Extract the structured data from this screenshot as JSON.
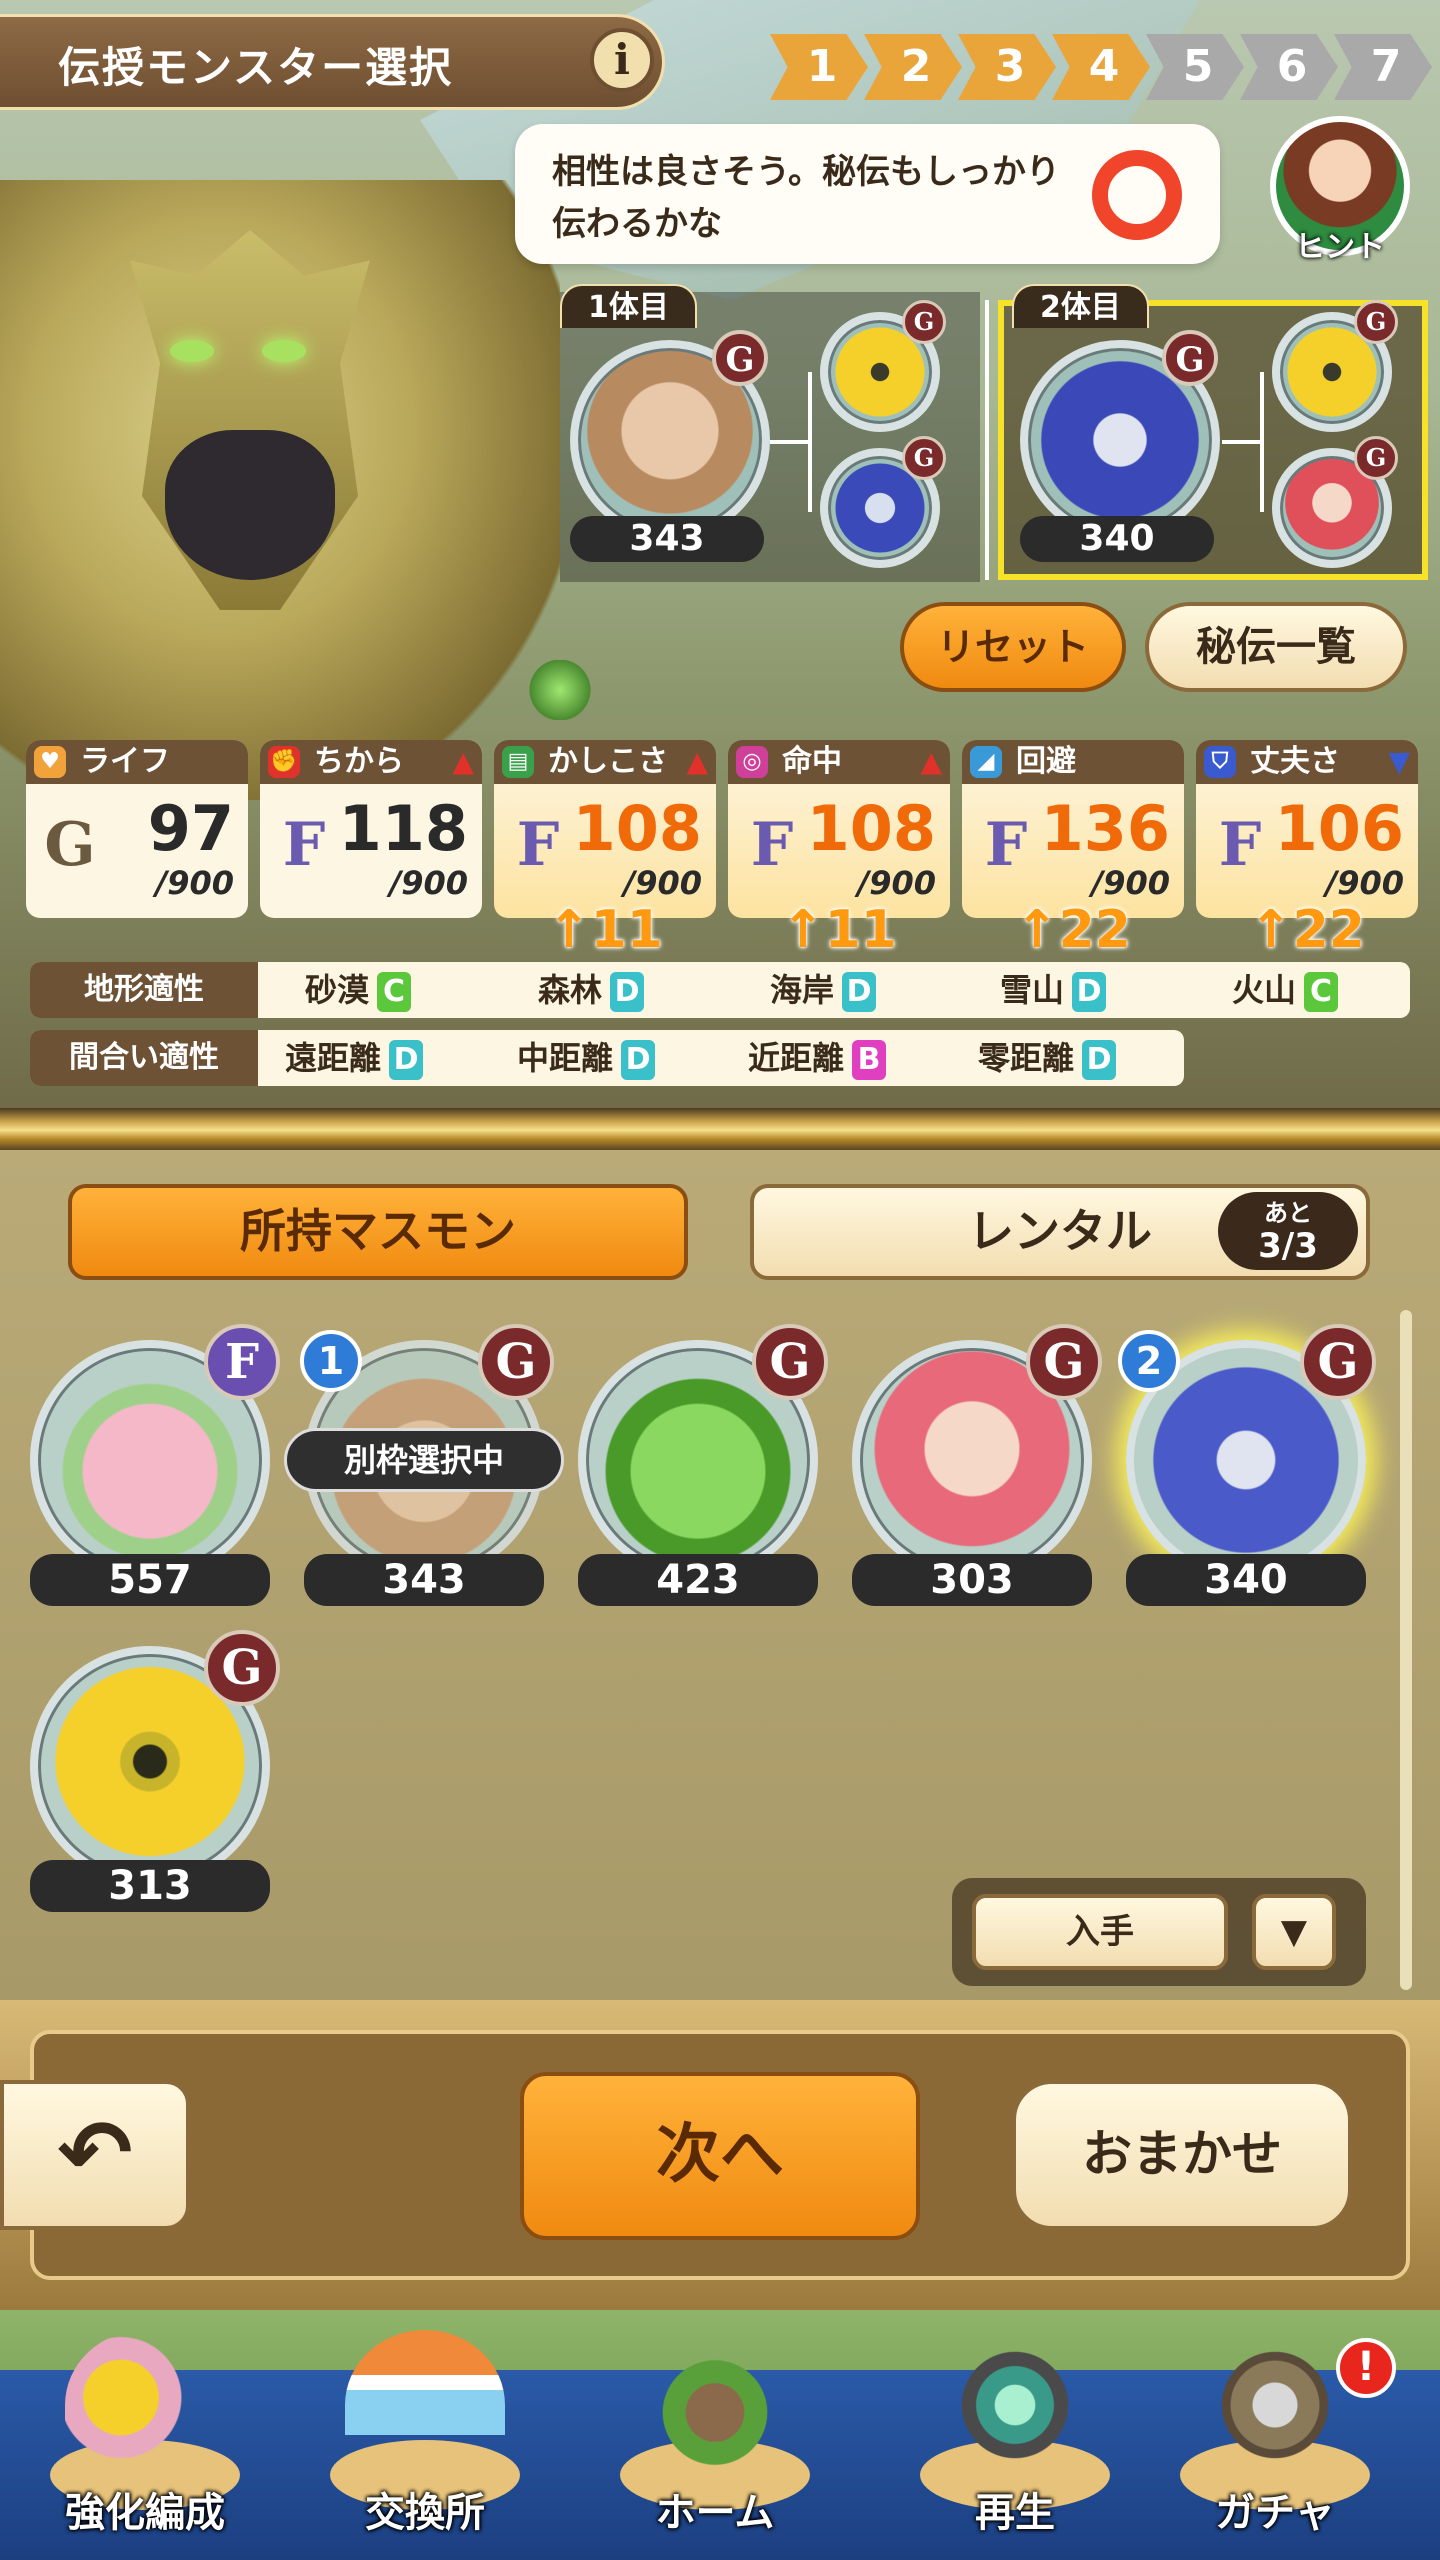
{
  "header": {
    "title": "伝授モンスター選択",
    "info_icon": "i",
    "steps": [
      "1",
      "2",
      "3",
      "4",
      "5",
      "6",
      "7"
    ],
    "current_step": 4
  },
  "hint": {
    "text": "相性は良さそう。秘伝もしっかり伝わるかな",
    "label": "ヒント",
    "rating_icon": "circle-mark"
  },
  "parents": [
    {
      "slot_label": "1体目",
      "level": "343",
      "grade": "G",
      "grade_label": "GRADE",
      "ancestors": [
        {
          "name": "yellow-one-eye",
          "grade": "G"
        },
        {
          "name": "blue-beast",
          "grade": "G"
        }
      ]
    },
    {
      "slot_label": "2体目",
      "level": "340",
      "grade": "G",
      "grade_label": "GRADE",
      "ancestors": [
        {
          "name": "yellow-one-eye",
          "grade": "G"
        },
        {
          "name": "red-hair-girl",
          "grade": "G"
        }
      ]
    }
  ],
  "actions": {
    "reset": "リセット",
    "secret_list": "秘伝一覧"
  },
  "stats": [
    {
      "name": "ライフ",
      "grade": "G",
      "value": "97",
      "max": "/900",
      "boost": "",
      "trend": "",
      "icon_color": "#f2a23a"
    },
    {
      "name": "ちから",
      "grade": "F",
      "value": "118",
      "max": "/900",
      "boost": "",
      "trend": "▲",
      "icon_color": "#e0322a"
    },
    {
      "name": "かしこさ",
      "grade": "F",
      "value": "108",
      "max": "/900",
      "boost": "↑11",
      "trend": "▲",
      "icon_color": "#3aa04a"
    },
    {
      "name": "命中",
      "grade": "F",
      "value": "108",
      "max": "/900",
      "boost": "↑11",
      "trend": "▲",
      "icon_color": "#d0409a"
    },
    {
      "name": "回避",
      "grade": "F",
      "value": "136",
      "max": "/900",
      "boost": "↑22",
      "trend": "",
      "icon_color": "#3a9ad8"
    },
    {
      "name": "丈夫さ",
      "grade": "F",
      "value": "106",
      "max": "/900",
      "boost": "↑22",
      "trend": "▼",
      "icon_color": "#3a5ad0"
    }
  ],
  "terrain": {
    "label": "地形適性",
    "items": [
      {
        "name": "砂漠",
        "grade": "C"
      },
      {
        "name": "森林",
        "grade": "D"
      },
      {
        "name": "海岸",
        "grade": "D"
      },
      {
        "name": "雪山",
        "grade": "D"
      },
      {
        "name": "火山",
        "grade": "C"
      }
    ]
  },
  "range": {
    "label": "間合い適性",
    "items": [
      {
        "name": "遠距離",
        "grade": "D"
      },
      {
        "name": "中距離",
        "grade": "D"
      },
      {
        "name": "近距離",
        "grade": "B"
      },
      {
        "name": "零距離",
        "grade": "D"
      }
    ]
  },
  "grade_colors": {
    "B": "#e040c0",
    "C": "#5ac83a",
    "D": "#3ac0c8"
  },
  "list": {
    "owned_tab": "所持マスモン",
    "rental_tab": "レンタル",
    "rental_remaining_label": "あと",
    "rental_remaining": "3/3",
    "monsters": [
      {
        "level": "557",
        "grade": "F",
        "order": "",
        "selected_label": "",
        "color": "#f4b8c8"
      },
      {
        "level": "343",
        "grade": "G",
        "order": "1",
        "selected_label": "別枠選択中",
        "color": "#c8a07a"
      },
      {
        "level": "423",
        "grade": "G",
        "order": "",
        "selected_label": "",
        "color": "#5cb83a"
      },
      {
        "level": "303",
        "grade": "G",
        "order": "",
        "selected_label": "",
        "color": "#e86a7a"
      },
      {
        "level": "340",
        "grade": "G",
        "order": "2",
        "selected_label": "",
        "color": "#4a5ac8"
      },
      {
        "level": "313",
        "grade": "G",
        "order": "",
        "selected_label": "",
        "color": "#f2c42a"
      }
    ],
    "grade_label": "GRADE",
    "sort_label": "入手",
    "sort_dropdown": "▼"
  },
  "bottom": {
    "back": "↶",
    "next": "次へ",
    "auto": "おまかせ"
  },
  "nav": {
    "items": [
      "強化編成",
      "交換所",
      "ホーム",
      "再生",
      "ガチャ"
    ],
    "gacha_alert": "!"
  }
}
